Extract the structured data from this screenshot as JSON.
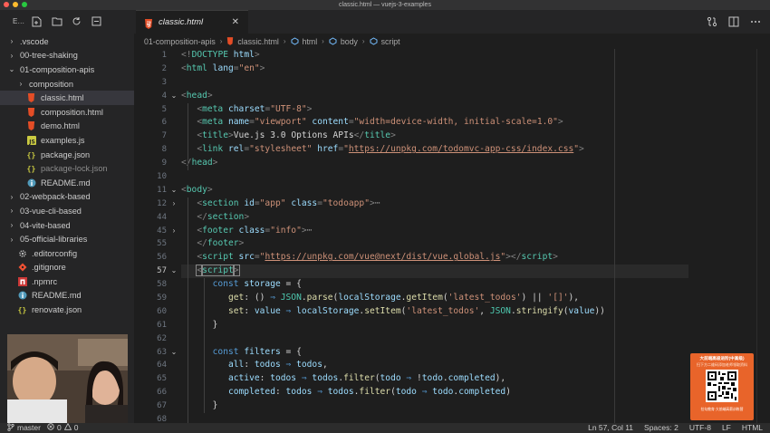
{
  "window": {
    "title": "classic.html — vuejs-3-examples",
    "traffic_colors": [
      "#fe5f57",
      "#febc2e",
      "#28c840"
    ]
  },
  "sidebar": {
    "label": "E...",
    "items": [
      {
        "label": ".vscode",
        "kind": "folder",
        "expanded": false,
        "depth": 0,
        "chevron": "›"
      },
      {
        "label": "00-tree-shaking",
        "kind": "folder",
        "expanded": false,
        "depth": 0,
        "chevron": "›"
      },
      {
        "label": "01-composition-apis",
        "kind": "folder",
        "expanded": true,
        "depth": 0,
        "chevron": "⌄"
      },
      {
        "label": "composition",
        "kind": "folder",
        "expanded": false,
        "depth": 1,
        "chevron": "›"
      },
      {
        "label": "classic.html",
        "kind": "html",
        "depth": 1,
        "selected": true
      },
      {
        "label": "composition.html",
        "kind": "html",
        "depth": 1
      },
      {
        "label": "demo.html",
        "kind": "html",
        "depth": 1
      },
      {
        "label": "examples.js",
        "kind": "js",
        "depth": 1
      },
      {
        "label": "package.json",
        "kind": "json",
        "depth": 1
      },
      {
        "label": "package-lock.json",
        "kind": "json",
        "depth": 1,
        "dim": true
      },
      {
        "label": "README.md",
        "kind": "info",
        "depth": 1
      },
      {
        "label": "02-webpack-based",
        "kind": "folder",
        "expanded": false,
        "depth": 0,
        "chevron": "›"
      },
      {
        "label": "03-vue-cli-based",
        "kind": "folder",
        "expanded": false,
        "depth": 0,
        "chevron": "›"
      },
      {
        "label": "04-vite-based",
        "kind": "folder",
        "expanded": false,
        "depth": 0,
        "chevron": "›"
      },
      {
        "label": "05-official-libraries",
        "kind": "folder",
        "expanded": false,
        "depth": 0,
        "chevron": "›"
      },
      {
        "label": ".editorconfig",
        "kind": "gear",
        "depth": 0
      },
      {
        "label": ".gitignore",
        "kind": "git",
        "depth": 0
      },
      {
        "label": ".npmrc",
        "kind": "npm",
        "depth": 0
      },
      {
        "label": "README.md",
        "kind": "info",
        "depth": 0
      },
      {
        "label": "renovate.json",
        "kind": "json",
        "depth": 0
      }
    ]
  },
  "tab": {
    "label": "classic.html",
    "close": "✕"
  },
  "breadcrumb": [
    "01-composition-apis",
    "classic.html",
    "html",
    "body",
    "script"
  ],
  "editor": {
    "active_line": 57,
    "lines": [
      {
        "n": "1",
        "fold": "",
        "indent": 0,
        "tokens": [
          [
            "p",
            "<!"
          ],
          [
            "g",
            "DOCTYPE"
          ],
          [
            "a",
            " html"
          ],
          [
            "p",
            ">"
          ]
        ]
      },
      {
        "n": "2",
        "fold": "",
        "indent": 0,
        "tokens": [
          [
            "p",
            "<"
          ],
          [
            "g",
            "html"
          ],
          [
            "a",
            " lang"
          ],
          [
            "p",
            "="
          ],
          [
            "s",
            "\"en\""
          ],
          [
            "p",
            ">"
          ]
        ]
      },
      {
        "n": "3",
        "fold": "",
        "indent": 0,
        "tokens": []
      },
      {
        "n": "4",
        "fold": "⌄",
        "indent": 0,
        "tokens": [
          [
            "p",
            "<"
          ],
          [
            "g",
            "head"
          ],
          [
            "p",
            ">"
          ]
        ]
      },
      {
        "n": "5",
        "fold": "",
        "indent": 1,
        "tokens": [
          [
            "p",
            "<"
          ],
          [
            "g",
            "meta"
          ],
          [
            "a",
            " charset"
          ],
          [
            "p",
            "="
          ],
          [
            "s",
            "\"UTF-8\""
          ],
          [
            "p",
            ">"
          ]
        ]
      },
      {
        "n": "6",
        "fold": "",
        "indent": 1,
        "tokens": [
          [
            "p",
            "<"
          ],
          [
            "g",
            "meta"
          ],
          [
            "a",
            " name"
          ],
          [
            "p",
            "="
          ],
          [
            "s",
            "\"viewport\""
          ],
          [
            "a",
            " content"
          ],
          [
            "p",
            "="
          ],
          [
            "s",
            "\"width=device-width, initial-scale=1.0\""
          ],
          [
            "p",
            ">"
          ]
        ]
      },
      {
        "n": "7",
        "fold": "",
        "indent": 1,
        "tokens": [
          [
            "p",
            "<"
          ],
          [
            "g",
            "title"
          ],
          [
            "p",
            ">"
          ],
          [
            "t",
            "Vue.js 3.0 Options APIs"
          ],
          [
            "p",
            "</"
          ],
          [
            "g",
            "title"
          ],
          [
            "p",
            ">"
          ]
        ]
      },
      {
        "n": "8",
        "fold": "",
        "indent": 1,
        "tokens": [
          [
            "p",
            "<"
          ],
          [
            "g",
            "link"
          ],
          [
            "a",
            " rel"
          ],
          [
            "p",
            "="
          ],
          [
            "s",
            "\"stylesheet\""
          ],
          [
            "a",
            " href"
          ],
          [
            "p",
            "="
          ],
          [
            "s",
            "\""
          ],
          [
            "u",
            "https://unpkg.com/todomvc-app-css/index.css"
          ],
          [
            "s",
            "\""
          ],
          [
            "p",
            ">"
          ]
        ]
      },
      {
        "n": "9",
        "fold": "",
        "indent": 0,
        "tokens": [
          [
            "p",
            "</"
          ],
          [
            "g",
            "head"
          ],
          [
            "p",
            ">"
          ]
        ]
      },
      {
        "n": "10",
        "fold": "",
        "indent": 0,
        "tokens": []
      },
      {
        "n": "11",
        "fold": "⌄",
        "indent": 0,
        "tokens": [
          [
            "p",
            "<"
          ],
          [
            "g",
            "body"
          ],
          [
            "p",
            ">"
          ]
        ]
      },
      {
        "n": "12",
        "fold": "›",
        "indent": 1,
        "tokens": [
          [
            "p",
            "<"
          ],
          [
            "g",
            "section"
          ],
          [
            "a",
            " id"
          ],
          [
            "p",
            "="
          ],
          [
            "s",
            "\"app\""
          ],
          [
            "a",
            " class"
          ],
          [
            "p",
            "="
          ],
          [
            "s",
            "\"todoapp\""
          ],
          [
            "p",
            ">"
          ],
          [
            "e",
            "⋯"
          ]
        ]
      },
      {
        "n": "44",
        "fold": "",
        "indent": 1,
        "tokens": [
          [
            "p",
            "</"
          ],
          [
            "g",
            "section"
          ],
          [
            "p",
            ">"
          ]
        ]
      },
      {
        "n": "45",
        "fold": "›",
        "indent": 1,
        "tokens": [
          [
            "p",
            "<"
          ],
          [
            "g",
            "footer"
          ],
          [
            "a",
            " class"
          ],
          [
            "p",
            "="
          ],
          [
            "s",
            "\"info\""
          ],
          [
            "p",
            ">"
          ],
          [
            "e",
            "⋯"
          ]
        ]
      },
      {
        "n": "55",
        "fold": "",
        "indent": 1,
        "tokens": [
          [
            "p",
            "</"
          ],
          [
            "g",
            "footer"
          ],
          [
            "p",
            ">"
          ]
        ]
      },
      {
        "n": "56",
        "fold": "",
        "indent": 1,
        "tokens": [
          [
            "p",
            "<"
          ],
          [
            "g",
            "script"
          ],
          [
            "a",
            " src"
          ],
          [
            "p",
            "="
          ],
          [
            "s",
            "\""
          ],
          [
            "u",
            "https://unpkg.com/vue@next/dist/vue.global.js"
          ],
          [
            "s",
            "\""
          ],
          [
            "p",
            "></"
          ],
          [
            "g",
            "script"
          ],
          [
            "p",
            ">"
          ]
        ]
      },
      {
        "n": "57",
        "fold": "⌄",
        "indent": 1,
        "tokens": [
          [
            "p",
            "<"
          ],
          [
            "g",
            "script"
          ],
          [
            "p",
            ">"
          ]
        ]
      },
      {
        "n": "58",
        "fold": "",
        "indent": 2,
        "tokens": [
          [
            "k",
            "const"
          ],
          [
            "v",
            " storage"
          ],
          [
            "t",
            " = {"
          ]
        ]
      },
      {
        "n": "59",
        "fold": "",
        "indent": 3,
        "tokens": [
          [
            "f",
            "get"
          ],
          [
            "t",
            ": () "
          ],
          [
            "k",
            "⇒"
          ],
          [
            "c",
            " JSON"
          ],
          [
            "t",
            "."
          ],
          [
            "f",
            "parse"
          ],
          [
            "t",
            "("
          ],
          [
            "v",
            "localStorage"
          ],
          [
            "t",
            "."
          ],
          [
            "f",
            "getItem"
          ],
          [
            "t",
            "("
          ],
          [
            "s",
            "'latest_todos'"
          ],
          [
            "t",
            ") "
          ],
          [
            "t",
            "||"
          ],
          [
            "s",
            " '[]'"
          ],
          [
            "t",
            "),"
          ]
        ]
      },
      {
        "n": "60",
        "fold": "",
        "indent": 3,
        "tokens": [
          [
            "f",
            "set"
          ],
          [
            "t",
            ": "
          ],
          [
            "v",
            "value"
          ],
          [
            "k",
            " ⇒"
          ],
          [
            "v",
            " localStorage"
          ],
          [
            "t",
            "."
          ],
          [
            "f",
            "setItem"
          ],
          [
            "t",
            "("
          ],
          [
            "s",
            "'latest_todos'"
          ],
          [
            "t",
            ", "
          ],
          [
            "c",
            "JSON"
          ],
          [
            "t",
            "."
          ],
          [
            "f",
            "stringify"
          ],
          [
            "t",
            "("
          ],
          [
            "v",
            "value"
          ],
          [
            "t",
            "))"
          ]
        ]
      },
      {
        "n": "61",
        "fold": "",
        "indent": 2,
        "tokens": [
          [
            "t",
            "}"
          ]
        ]
      },
      {
        "n": "62",
        "fold": "",
        "indent": 0,
        "tokens": []
      },
      {
        "n": "63",
        "fold": "⌄",
        "indent": 2,
        "tokens": [
          [
            "k",
            "const"
          ],
          [
            "v",
            " filters"
          ],
          [
            "t",
            " = {"
          ]
        ]
      },
      {
        "n": "64",
        "fold": "",
        "indent": 3,
        "tokens": [
          [
            "v",
            "all"
          ],
          [
            "t",
            ": "
          ],
          [
            "v",
            "todos"
          ],
          [
            "k",
            " ⇒"
          ],
          [
            "v",
            " todos"
          ],
          [
            "t",
            ","
          ]
        ]
      },
      {
        "n": "65",
        "fold": "",
        "indent": 3,
        "tokens": [
          [
            "v",
            "active"
          ],
          [
            "t",
            ": "
          ],
          [
            "v",
            "todos"
          ],
          [
            "k",
            " ⇒"
          ],
          [
            "v",
            " todos"
          ],
          [
            "t",
            "."
          ],
          [
            "f",
            "filter"
          ],
          [
            "t",
            "("
          ],
          [
            "v",
            "todo"
          ],
          [
            "k",
            " ⇒"
          ],
          [
            "t",
            " !"
          ],
          [
            "v",
            "todo"
          ],
          [
            "t",
            "."
          ],
          [
            "v",
            "completed"
          ],
          [
            "t",
            "),"
          ]
        ]
      },
      {
        "n": "66",
        "fold": "",
        "indent": 3,
        "tokens": [
          [
            "v",
            "completed"
          ],
          [
            "t",
            ": "
          ],
          [
            "v",
            "todos"
          ],
          [
            "k",
            " ⇒"
          ],
          [
            "v",
            " todos"
          ],
          [
            "t",
            "."
          ],
          [
            "f",
            "filter"
          ],
          [
            "t",
            "("
          ],
          [
            "v",
            "todo"
          ],
          [
            "k",
            " ⇒"
          ],
          [
            "v",
            " todo"
          ],
          [
            "t",
            "."
          ],
          [
            "v",
            "completed"
          ],
          [
            "t",
            ")"
          ]
        ]
      },
      {
        "n": "67",
        "fold": "",
        "indent": 2,
        "tokens": [
          [
            "t",
            "}"
          ]
        ]
      },
      {
        "n": "68",
        "fold": "",
        "indent": 0,
        "tokens": []
      }
    ]
  },
  "promo": {
    "line1": "大前端高级进阶(中高级)",
    "line2": "扫下方二维码添加老师领取资料",
    "line3": "拉勾教育·大前端高薪训练营"
  },
  "statusbar": {
    "branch": "master",
    "errors": "0",
    "warnings": "0",
    "position": "Ln 57, Col 11",
    "spaces": "Spaces: 2",
    "encoding": "UTF-8",
    "eol": "LF",
    "language": "HTML"
  }
}
